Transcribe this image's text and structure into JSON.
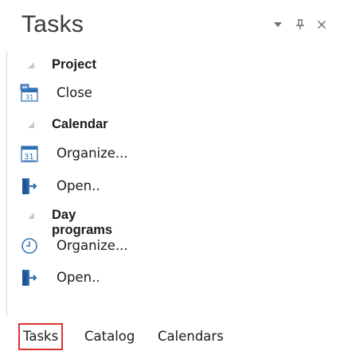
{
  "panel": {
    "title": "Tasks",
    "controls": {
      "menu_icon": "dropdown-triangle",
      "pin_icon": "pin",
      "close_icon": "close"
    }
  },
  "groups": [
    {
      "label": "Project",
      "items": [
        {
          "label": "Close",
          "icon": "calendar-31-close-icon"
        }
      ]
    },
    {
      "label": "Calendar",
      "items": [
        {
          "label": "Organize...",
          "icon": "calendar-31-icon"
        },
        {
          "label": "Open..",
          "icon": "open-door-icon"
        }
      ]
    },
    {
      "label": "Day programs",
      "items": [
        {
          "label": "Organize...",
          "icon": "clock-icon"
        },
        {
          "label": "Open..",
          "icon": "open-door-icon"
        }
      ]
    }
  ],
  "tabs": [
    {
      "label": "Tasks",
      "active": true
    },
    {
      "label": "Catalog",
      "active": false
    },
    {
      "label": "Calendars",
      "active": false
    }
  ],
  "colors": {
    "active_tab_outline": "#e0312e",
    "icon_blue": "#2f6fb6",
    "text": "#1a1a1a"
  }
}
